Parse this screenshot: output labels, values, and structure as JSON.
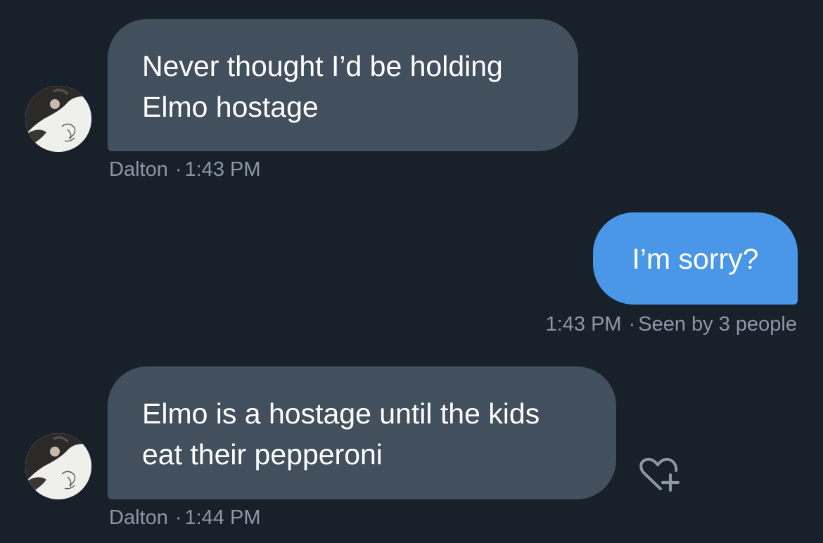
{
  "messages": [
    {
      "direction": "incoming",
      "text_lines": [
        "Never thought I’d be holding",
        "Elmo hostage"
      ],
      "sender": "Dalton",
      "separator": "·",
      "time": "1:43 PM"
    },
    {
      "direction": "outgoing",
      "text": "I’m sorry?",
      "time": "1:43 PM",
      "separator": "·",
      "seen": "Seen by 3 people"
    },
    {
      "direction": "incoming",
      "text_lines": [
        "Elmo is a hostage until the kids",
        "eat their pepperoni"
      ],
      "sender": "Dalton",
      "separator": "·",
      "time": "1:44 PM"
    }
  ],
  "icons": {
    "avatar": "avatar-photo",
    "reaction": "heart-plus-icon"
  },
  "colors": {
    "background": "#18202a",
    "incoming_bubble": "#424f5c",
    "outgoing_bubble": "#4a97e8",
    "meta_text": "#8b98a5"
  }
}
